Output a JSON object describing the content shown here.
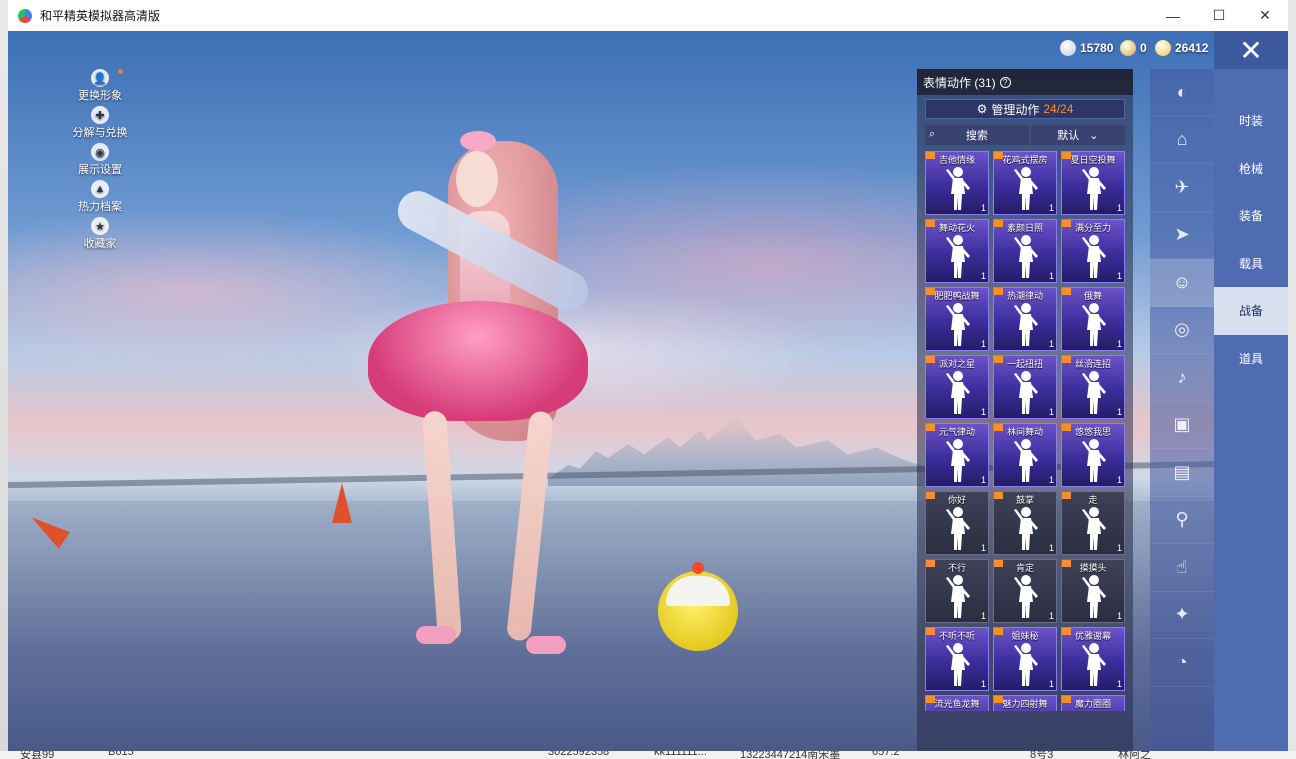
{
  "window": {
    "title": "和平精英模拟器高清版",
    "minimize_glyph": "—",
    "maximize_glyph": "☐",
    "close_glyph": "✕"
  },
  "currency": [
    {
      "icon": "coin-silver-icon",
      "value": "15780",
      "color": "#c0c7d8"
    },
    {
      "icon": "coin-medal-icon",
      "value": "0",
      "color": "#d9a52a"
    },
    {
      "icon": "coin-gold-icon",
      "value": "26412",
      "color": "#f2c33a"
    }
  ],
  "left_menu": [
    {
      "label": "更换形象",
      "icon": "avatar-icon",
      "glyph": "👤"
    },
    {
      "label": "分解与兑换",
      "icon": "puzzle-icon",
      "glyph": "✚"
    },
    {
      "label": "展示设置",
      "icon": "eye-icon",
      "glyph": "◉"
    },
    {
      "label": "热力档案",
      "icon": "flame-icon",
      "glyph": "▲"
    },
    {
      "label": "收藏家",
      "icon": "collector-badge-icon",
      "glyph": "★"
    }
  ],
  "panel": {
    "title": "表情动作 (31)",
    "help_glyph": "?",
    "manage_label": "管理动作",
    "manage_count": "24/24",
    "search_placeholder": "搜索",
    "sort_label": "默认"
  },
  "emotes": [
    {
      "name": "吉他情缘",
      "count": "1",
      "style": "rare"
    },
    {
      "name": "花鸡式摆房",
      "count": "1",
      "style": "rare"
    },
    {
      "name": "夏日空投舞",
      "count": "1",
      "style": "rare"
    },
    {
      "name": "舞动花火",
      "count": "1",
      "style": "rare"
    },
    {
      "name": "素颜日照",
      "count": "1",
      "style": "rare"
    },
    {
      "name": "满分至力",
      "count": "1",
      "style": "rare"
    },
    {
      "name": "肥肥鸭战舞",
      "count": "1",
      "style": "rare"
    },
    {
      "name": "热潮律动",
      "count": "1",
      "style": "rare"
    },
    {
      "name": "俄舞",
      "count": "1",
      "style": "rare"
    },
    {
      "name": "派对之星",
      "count": "1",
      "style": "rare"
    },
    {
      "name": "一起扭扭",
      "count": "1",
      "style": "rare"
    },
    {
      "name": "丝滑连招",
      "count": "1",
      "style": "rare"
    },
    {
      "name": "元气律动",
      "count": "1",
      "style": "rare"
    },
    {
      "name": "林间舞动",
      "count": "1",
      "style": "rare"
    },
    {
      "name": "悠悠我思",
      "count": "1",
      "style": "rare"
    },
    {
      "name": "你好",
      "count": "1",
      "style": "plain"
    },
    {
      "name": "鼓掌",
      "count": "1",
      "style": "plain"
    },
    {
      "name": "走",
      "count": "1",
      "style": "plain"
    },
    {
      "name": "不行",
      "count": "1",
      "style": "plain"
    },
    {
      "name": "肯定",
      "count": "1",
      "style": "plain"
    },
    {
      "name": "摸摸头",
      "count": "1",
      "style": "plain"
    },
    {
      "name": "不听不听",
      "count": "1",
      "style": "rare"
    },
    {
      "name": "姐妹秘",
      "count": "1",
      "style": "rare"
    },
    {
      "name": "优雅谢幕",
      "count": "1",
      "style": "rare"
    },
    {
      "name": "流光鱼龙舞",
      "count": "1",
      "style": "rare"
    },
    {
      "name": "魅力四射舞",
      "count": "1",
      "style": "rare"
    },
    {
      "name": "魔力圈圈",
      "count": "1",
      "style": "rare"
    }
  ],
  "categories": [
    {
      "icon": "fan-icon",
      "glyph": "◐",
      "active": false
    },
    {
      "icon": "shoe-icon",
      "glyph": "⌂",
      "active": false
    },
    {
      "icon": "drone-icon",
      "glyph": "✈",
      "active": false
    },
    {
      "icon": "plane-icon",
      "glyph": "➤",
      "active": false
    },
    {
      "icon": "emote-face-icon",
      "glyph": "☺",
      "active": true
    },
    {
      "icon": "robot-icon",
      "glyph": "◎",
      "active": false
    },
    {
      "icon": "speaker-icon",
      "glyph": "♪",
      "active": false
    },
    {
      "icon": "pet-icon",
      "glyph": "▣",
      "active": false
    },
    {
      "icon": "photo-frame-icon",
      "glyph": "▤",
      "active": false
    },
    {
      "icon": "extinguisher-icon",
      "glyph": "⚲",
      "active": false
    },
    {
      "icon": "hand-tap-icon",
      "glyph": "☝",
      "active": false
    },
    {
      "icon": "magic-wand-icon",
      "glyph": "✦",
      "active": false
    },
    {
      "icon": "ufo-icon",
      "glyph": "◔",
      "active": false
    }
  ],
  "right_tabs": [
    {
      "label": "时装",
      "active": false
    },
    {
      "label": "枪械",
      "active": false
    },
    {
      "label": "装备",
      "active": false
    },
    {
      "label": "载具",
      "active": false
    },
    {
      "label": "战备",
      "active": true
    },
    {
      "label": "道具",
      "active": false
    }
  ],
  "close_overlay_glyph": "✕",
  "bottom_sheet": [
    "安县99",
    "B615",
    "3022592358",
    "kk111111...",
    "13223447214南宋墨",
    "657.2",
    "8号3",
    "林阿之"
  ]
}
